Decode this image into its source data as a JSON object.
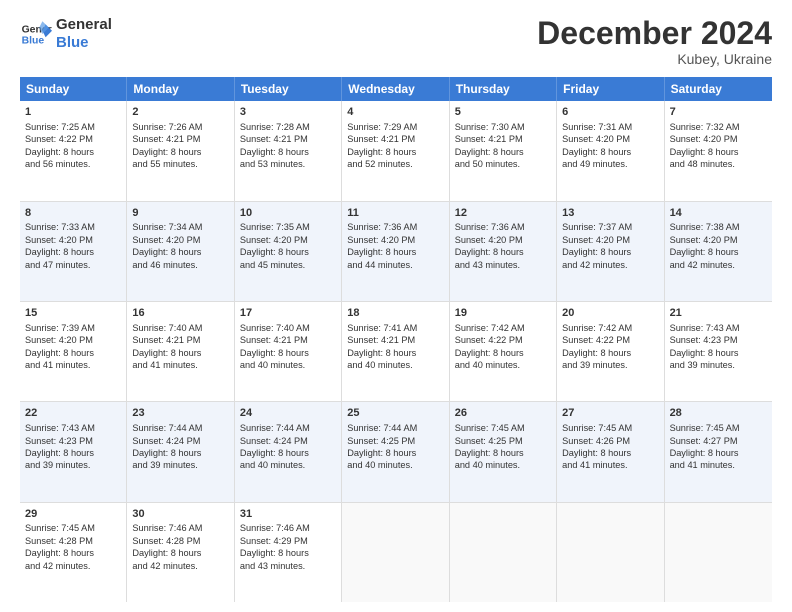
{
  "header": {
    "logo_line1": "General",
    "logo_line2": "Blue",
    "month": "December 2024",
    "location": "Kubey, Ukraine"
  },
  "weekdays": [
    "Sunday",
    "Monday",
    "Tuesday",
    "Wednesday",
    "Thursday",
    "Friday",
    "Saturday"
  ],
  "rows": [
    {
      "alt": false,
      "cells": [
        {
          "day": "1",
          "lines": [
            "Sunrise: 7:25 AM",
            "Sunset: 4:22 PM",
            "Daylight: 8 hours",
            "and 56 minutes."
          ]
        },
        {
          "day": "2",
          "lines": [
            "Sunrise: 7:26 AM",
            "Sunset: 4:21 PM",
            "Daylight: 8 hours",
            "and 55 minutes."
          ]
        },
        {
          "day": "3",
          "lines": [
            "Sunrise: 7:28 AM",
            "Sunset: 4:21 PM",
            "Daylight: 8 hours",
            "and 53 minutes."
          ]
        },
        {
          "day": "4",
          "lines": [
            "Sunrise: 7:29 AM",
            "Sunset: 4:21 PM",
            "Daylight: 8 hours",
            "and 52 minutes."
          ]
        },
        {
          "day": "5",
          "lines": [
            "Sunrise: 7:30 AM",
            "Sunset: 4:21 PM",
            "Daylight: 8 hours",
            "and 50 minutes."
          ]
        },
        {
          "day": "6",
          "lines": [
            "Sunrise: 7:31 AM",
            "Sunset: 4:20 PM",
            "Daylight: 8 hours",
            "and 49 minutes."
          ]
        },
        {
          "day": "7",
          "lines": [
            "Sunrise: 7:32 AM",
            "Sunset: 4:20 PM",
            "Daylight: 8 hours",
            "and 48 minutes."
          ]
        }
      ]
    },
    {
      "alt": true,
      "cells": [
        {
          "day": "8",
          "lines": [
            "Sunrise: 7:33 AM",
            "Sunset: 4:20 PM",
            "Daylight: 8 hours",
            "and 47 minutes."
          ]
        },
        {
          "day": "9",
          "lines": [
            "Sunrise: 7:34 AM",
            "Sunset: 4:20 PM",
            "Daylight: 8 hours",
            "and 46 minutes."
          ]
        },
        {
          "day": "10",
          "lines": [
            "Sunrise: 7:35 AM",
            "Sunset: 4:20 PM",
            "Daylight: 8 hours",
            "and 45 minutes."
          ]
        },
        {
          "day": "11",
          "lines": [
            "Sunrise: 7:36 AM",
            "Sunset: 4:20 PM",
            "Daylight: 8 hours",
            "and 44 minutes."
          ]
        },
        {
          "day": "12",
          "lines": [
            "Sunrise: 7:36 AM",
            "Sunset: 4:20 PM",
            "Daylight: 8 hours",
            "and 43 minutes."
          ]
        },
        {
          "day": "13",
          "lines": [
            "Sunrise: 7:37 AM",
            "Sunset: 4:20 PM",
            "Daylight: 8 hours",
            "and 42 minutes."
          ]
        },
        {
          "day": "14",
          "lines": [
            "Sunrise: 7:38 AM",
            "Sunset: 4:20 PM",
            "Daylight: 8 hours",
            "and 42 minutes."
          ]
        }
      ]
    },
    {
      "alt": false,
      "cells": [
        {
          "day": "15",
          "lines": [
            "Sunrise: 7:39 AM",
            "Sunset: 4:20 PM",
            "Daylight: 8 hours",
            "and 41 minutes."
          ]
        },
        {
          "day": "16",
          "lines": [
            "Sunrise: 7:40 AM",
            "Sunset: 4:21 PM",
            "Daylight: 8 hours",
            "and 41 minutes."
          ]
        },
        {
          "day": "17",
          "lines": [
            "Sunrise: 7:40 AM",
            "Sunset: 4:21 PM",
            "Daylight: 8 hours",
            "and 40 minutes."
          ]
        },
        {
          "day": "18",
          "lines": [
            "Sunrise: 7:41 AM",
            "Sunset: 4:21 PM",
            "Daylight: 8 hours",
            "and 40 minutes."
          ]
        },
        {
          "day": "19",
          "lines": [
            "Sunrise: 7:42 AM",
            "Sunset: 4:22 PM",
            "Daylight: 8 hours",
            "and 40 minutes."
          ]
        },
        {
          "day": "20",
          "lines": [
            "Sunrise: 7:42 AM",
            "Sunset: 4:22 PM",
            "Daylight: 8 hours",
            "and 39 minutes."
          ]
        },
        {
          "day": "21",
          "lines": [
            "Sunrise: 7:43 AM",
            "Sunset: 4:23 PM",
            "Daylight: 8 hours",
            "and 39 minutes."
          ]
        }
      ]
    },
    {
      "alt": true,
      "cells": [
        {
          "day": "22",
          "lines": [
            "Sunrise: 7:43 AM",
            "Sunset: 4:23 PM",
            "Daylight: 8 hours",
            "and 39 minutes."
          ]
        },
        {
          "day": "23",
          "lines": [
            "Sunrise: 7:44 AM",
            "Sunset: 4:24 PM",
            "Daylight: 8 hours",
            "and 39 minutes."
          ]
        },
        {
          "day": "24",
          "lines": [
            "Sunrise: 7:44 AM",
            "Sunset: 4:24 PM",
            "Daylight: 8 hours",
            "and 40 minutes."
          ]
        },
        {
          "day": "25",
          "lines": [
            "Sunrise: 7:44 AM",
            "Sunset: 4:25 PM",
            "Daylight: 8 hours",
            "and 40 minutes."
          ]
        },
        {
          "day": "26",
          "lines": [
            "Sunrise: 7:45 AM",
            "Sunset: 4:25 PM",
            "Daylight: 8 hours",
            "and 40 minutes."
          ]
        },
        {
          "day": "27",
          "lines": [
            "Sunrise: 7:45 AM",
            "Sunset: 4:26 PM",
            "Daylight: 8 hours",
            "and 41 minutes."
          ]
        },
        {
          "day": "28",
          "lines": [
            "Sunrise: 7:45 AM",
            "Sunset: 4:27 PM",
            "Daylight: 8 hours",
            "and 41 minutes."
          ]
        }
      ]
    },
    {
      "alt": false,
      "cells": [
        {
          "day": "29",
          "lines": [
            "Sunrise: 7:45 AM",
            "Sunset: 4:28 PM",
            "Daylight: 8 hours",
            "and 42 minutes."
          ]
        },
        {
          "day": "30",
          "lines": [
            "Sunrise: 7:46 AM",
            "Sunset: 4:28 PM",
            "Daylight: 8 hours",
            "and 42 minutes."
          ]
        },
        {
          "day": "31",
          "lines": [
            "Sunrise: 7:46 AM",
            "Sunset: 4:29 PM",
            "Daylight: 8 hours",
            "and 43 minutes."
          ]
        },
        {
          "day": "",
          "lines": []
        },
        {
          "day": "",
          "lines": []
        },
        {
          "day": "",
          "lines": []
        },
        {
          "day": "",
          "lines": []
        }
      ]
    }
  ]
}
